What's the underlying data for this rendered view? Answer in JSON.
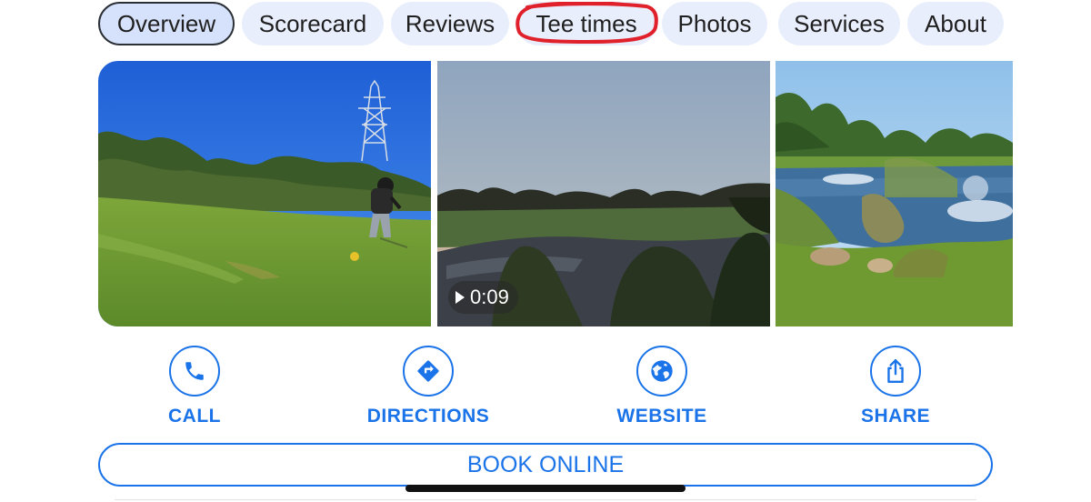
{
  "tabs": [
    {
      "label": "Overview",
      "active": true
    },
    {
      "label": "Scorecard",
      "active": false
    },
    {
      "label": "Reviews",
      "active": false
    },
    {
      "label": "Tee times",
      "active": false,
      "highlighted": true
    },
    {
      "label": "Photos",
      "active": false
    },
    {
      "label": "Services",
      "active": false
    },
    {
      "label": "About",
      "active": false
    }
  ],
  "photos": [
    {
      "description_icon": "photo-thumbnail"
    },
    {
      "description_icon": "video-thumbnail",
      "video_duration": "0:09"
    },
    {
      "description_icon": "photo-thumbnail"
    }
  ],
  "actions": [
    {
      "label": "CALL",
      "icon": "phone-icon"
    },
    {
      "label": "DIRECTIONS",
      "icon": "directions-icon"
    },
    {
      "label": "WEBSITE",
      "icon": "globe-icon"
    },
    {
      "label": "SHARE",
      "icon": "share-icon"
    }
  ],
  "book_online": {
    "label": "BOOK ONLINE"
  },
  "colors": {
    "accent": "#1a73e8",
    "tab_bg": "#e8eefb",
    "tab_active_bg": "#d6e2fb",
    "highlight_annotation": "#e0202a"
  }
}
